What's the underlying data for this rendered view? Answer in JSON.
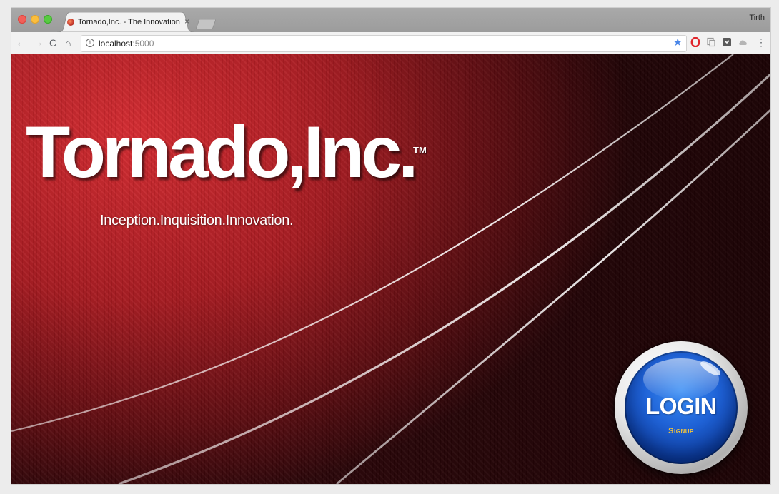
{
  "browser": {
    "tab": {
      "title": "Tornado,Inc. - The Innovation",
      "close": "×",
      "favicon": "tornado-favicon-icon"
    },
    "profile_name": "Tirth",
    "nav": {
      "back": "←",
      "forward": "→",
      "reload": "C",
      "home": "⌂"
    },
    "address": {
      "host": "localhost",
      "port": ":5000",
      "info_glyph": "i",
      "bookmark": "★"
    },
    "extensions": [
      "opera-icon",
      "copy-icon",
      "pocket-icon",
      "cloud-icon"
    ],
    "menu": "⋮"
  },
  "page": {
    "brand": "Tornado,Inc.",
    "trademark": "TM",
    "tagline": "Inception.Inquisition.Innovation.",
    "login_button": {
      "label": "LOGIN",
      "sublabel": "Signup"
    }
  },
  "colors": {
    "background_red": "#a61a20",
    "button_blue": "#1f62d6",
    "signup_gold": "#f3c43b"
  }
}
